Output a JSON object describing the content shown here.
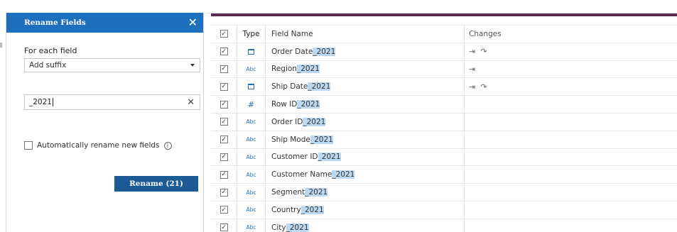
{
  "panel": {
    "title": "Rename Fields",
    "section_label": "For each field",
    "mode_select": "Add suffix",
    "suffix_value": "_2021",
    "auto_rename_label": "Automatically rename new fields",
    "rename_button": "Rename (21)"
  },
  "table": {
    "headers": {
      "type": "Type",
      "field_name": "Field Name",
      "changes": "Changes"
    },
    "rows": [
      {
        "type": "date",
        "name": "Order Date",
        "suffix": "_2021",
        "changes": [
          "rename-icon",
          "type-change-icon"
        ]
      },
      {
        "type": "string",
        "name": "Region",
        "suffix": "_2021",
        "changes": [
          "rename-icon"
        ]
      },
      {
        "type": "date",
        "name": "Ship Date",
        "suffix": "_2021",
        "changes": [
          "rename-icon",
          "type-change-icon"
        ]
      },
      {
        "type": "number",
        "name": "Row ID",
        "suffix": "_2021",
        "changes": []
      },
      {
        "type": "string",
        "name": "Order ID",
        "suffix": "_2021",
        "changes": []
      },
      {
        "type": "string",
        "name": "Ship Mode",
        "suffix": "_2021",
        "changes": []
      },
      {
        "type": "string",
        "name": "Customer ID",
        "suffix": "_2021",
        "changes": []
      },
      {
        "type": "string",
        "name": "Customer Name",
        "suffix": "_2021",
        "changes": []
      },
      {
        "type": "string",
        "name": "Segment",
        "suffix": "_2021",
        "changes": []
      },
      {
        "type": "string",
        "name": "Country",
        "suffix": "_2021",
        "changes": []
      },
      {
        "type": "string",
        "name": "City",
        "suffix": "_2021",
        "changes": []
      }
    ]
  },
  "labels": {
    "abc": "Abc",
    "hash": "#"
  },
  "colors": {
    "header": "#1f6fbf",
    "button": "#1b5a94",
    "highlight": "#bcd9f1",
    "accent_bar": "#5c2a52"
  }
}
